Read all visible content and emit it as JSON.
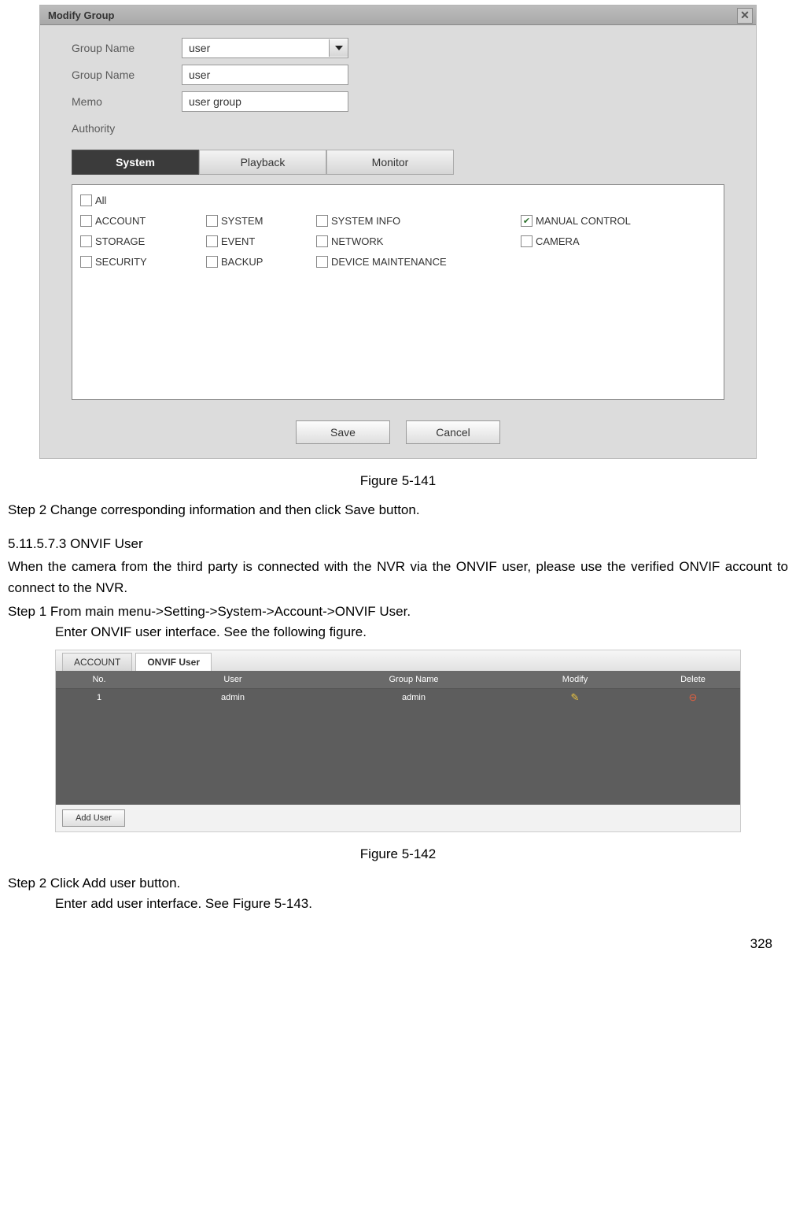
{
  "dialog": {
    "title": "Modify Group",
    "fields": {
      "groupName1_label": "Group Name",
      "groupName1_value": "user",
      "groupName2_label": "Group Name",
      "groupName2_value": "user",
      "memo_label": "Memo",
      "memo_value": "user group",
      "authority_label": "Authority"
    },
    "tabs": {
      "system": "System",
      "playback": "Playback",
      "monitor": "Monitor"
    },
    "auth": {
      "all": "All",
      "account": "ACCOUNT",
      "storage": "STORAGE",
      "security": "SECURITY",
      "system": "SYSTEM",
      "event": "EVENT",
      "backup": "BACKUP",
      "systemInfo": "SYSTEM INFO",
      "network": "NETWORK",
      "deviceMaint": "DEVICE MAINTENANCE",
      "manualControl": "MANUAL CONTROL",
      "camera": "CAMERA"
    },
    "save": "Save",
    "cancel": "Cancel"
  },
  "caption1": "Figure 5-141",
  "step2a": "Step 2    Change corresponding information and then click Save button.",
  "section": "5.11.5.7.3  ONVIF User",
  "para": "When the camera from the third party is connected with the NVR via the ONVIF user, please use the verified ONVIF account to connect to the NVR.",
  "step1": "Step 1    From main menu->Setting->System->Account->ONVIF User.",
  "step1b": "Enter ONVIF user interface. See the following figure.",
  "onvif": {
    "tab_account": "ACCOUNT",
    "tab_onvif": "ONVIF User",
    "hdr_no": "No.",
    "hdr_user": "User",
    "hdr_group": "Group Name",
    "hdr_modify": "Modify",
    "hdr_delete": "Delete",
    "row1_no": "1",
    "row1_user": "admin",
    "row1_group": "admin",
    "add_user": "Add User"
  },
  "caption2": "Figure 5-142",
  "step2b": "Step 2   Click Add user button.",
  "step2c": "Enter add user interface. See Figure 5-143.",
  "pageNumber": "328"
}
